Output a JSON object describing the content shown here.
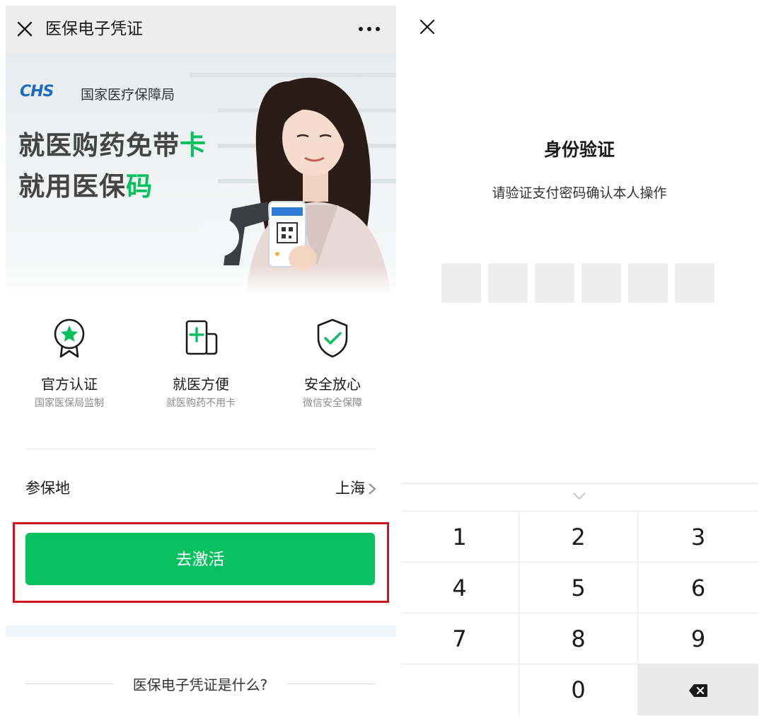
{
  "left": {
    "title": "医保电子凭证",
    "banner": {
      "logo": "CHS",
      "org": "国家医疗保障局",
      "headline1_main": "就医购药免带",
      "headline1_accent": "卡",
      "headline2_main": "就用医保",
      "headline2_accent": "码",
      "accent_color": "#07c160"
    },
    "features": [
      {
        "icon": "badge-star-icon",
        "title": "官方认证",
        "subtitle": "国家医保局监制"
      },
      {
        "icon": "medical-card-icon",
        "title": "就医方便",
        "subtitle": "就医购药不用卡"
      },
      {
        "icon": "shield-check-icon",
        "title": "安全放心",
        "subtitle": "微信安全保障"
      }
    ],
    "region": {
      "label": "参保地",
      "value": "上海"
    },
    "activate_label": "去激活",
    "highlight_color": "#d0141d",
    "faq": "医保电子凭证是什么?"
  },
  "right": {
    "title": "身份验证",
    "subtitle": "请验证支付密码确认本人操作",
    "keys": [
      "1",
      "2",
      "3",
      "4",
      "5",
      "6",
      "7",
      "8",
      "9",
      "",
      "0",
      "delete-icon"
    ]
  }
}
